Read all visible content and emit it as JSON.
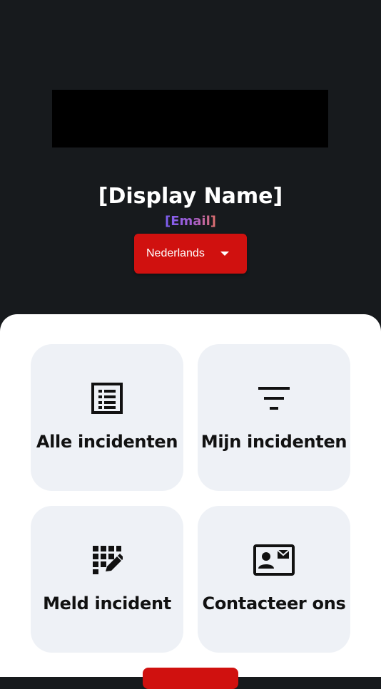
{
  "profile": {
    "display_name": "[Display Name]",
    "email": "[Email]"
  },
  "language": {
    "selected": "Nederlands"
  },
  "tiles": [
    {
      "label": "Alle incidenten",
      "icon": "list-icon"
    },
    {
      "label": "Mijn incidenten",
      "icon": "filter-icon"
    },
    {
      "label": "Meld incident",
      "icon": "edit-grid-icon"
    },
    {
      "label": "Contacteer ons",
      "icon": "contact-card-icon"
    }
  ],
  "colors": {
    "background": "#171a1d",
    "accent": "#d0110f",
    "tile": "#eef1f6"
  }
}
